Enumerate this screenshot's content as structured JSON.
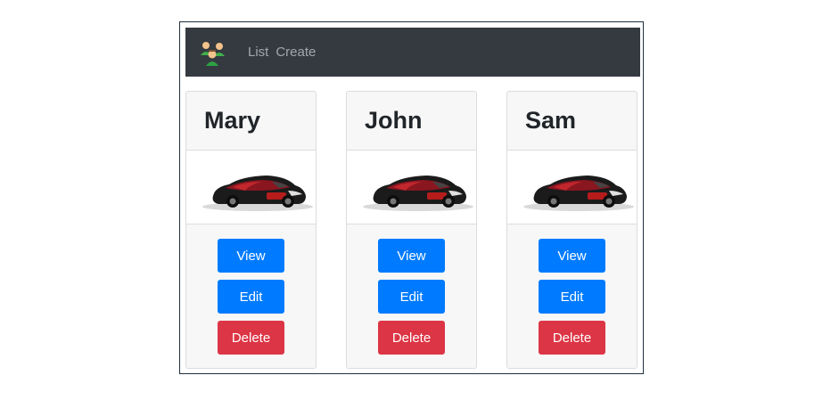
{
  "nav": {
    "logo_icon": "people-group-icon",
    "links": [
      "List",
      "Create"
    ]
  },
  "cards": [
    {
      "name": "Mary",
      "image": "sports-car-image",
      "view_label": "View",
      "edit_label": "Edit",
      "delete_label": "Delete"
    },
    {
      "name": "John",
      "image": "sports-car-image",
      "view_label": "View",
      "edit_label": "Edit",
      "delete_label": "Delete"
    },
    {
      "name": "Sam",
      "image": "sports-car-image",
      "view_label": "View",
      "edit_label": "Edit",
      "delete_label": "Delete"
    }
  ],
  "colors": {
    "navbar": "#343a40",
    "primary": "#007bff",
    "danger": "#dc3545"
  }
}
